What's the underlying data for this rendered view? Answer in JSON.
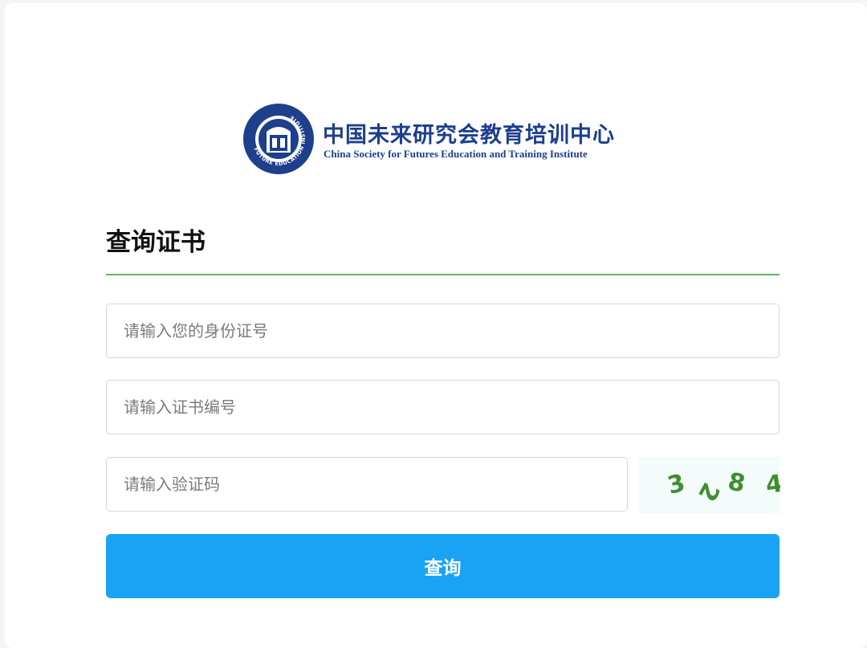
{
  "logo": {
    "name_cn": "中国未来研究会教育培训中心",
    "name_en": "China Society for Futures Education and Training Institute",
    "seal_text": "FUTURE EDUCATION INSTITUTE",
    "color": "#1d3f8c"
  },
  "form": {
    "title": "查询证书",
    "id_placeholder": "请输入您的身份证号",
    "cert_placeholder": "请输入证书编号",
    "code_placeholder": "请输入验证码",
    "captcha": {
      "chars": [
        "3",
        "2",
        "8",
        "4"
      ],
      "color": "#3f8f2f"
    },
    "submit_label": "查询",
    "accent_color": "#5cb85c",
    "button_color": "#1aa3f5"
  }
}
